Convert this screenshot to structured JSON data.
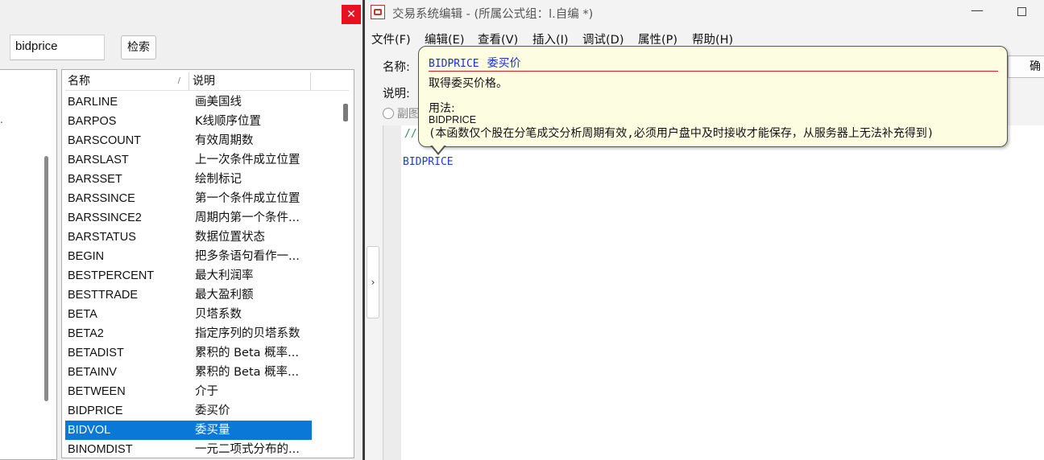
{
  "picker": {
    "search_value": "bidprice",
    "search_button": "检索",
    "columns": {
      "name": "名称",
      "desc": "说明",
      "sort_mark": "/"
    },
    "rows": [
      {
        "name": "BARLINE",
        "desc": "画美国线"
      },
      {
        "name": "BARPOS",
        "desc": "K线顺序位置"
      },
      {
        "name": "BARSCOUNT",
        "desc": "有效周期数"
      },
      {
        "name": "BARSLAST",
        "desc": "上一次条件成立位置"
      },
      {
        "name": "BARSSET",
        "desc": "绘制标记"
      },
      {
        "name": "BARSSINCE",
        "desc": "第一个条件成立位置"
      },
      {
        "name": "BARSSINCE2",
        "desc": "周期内第一个条件..."
      },
      {
        "name": "BARSTATUS",
        "desc": "数据位置状态"
      },
      {
        "name": "BEGIN",
        "desc": "把多条语句看作一..."
      },
      {
        "name": "BESTPERCENT",
        "desc": "最大利润率"
      },
      {
        "name": "BESTTRADE",
        "desc": "最大盈利额"
      },
      {
        "name": "BETA",
        "desc": "贝塔系数"
      },
      {
        "name": "BETA2",
        "desc": "指定序列的贝塔系数"
      },
      {
        "name": "BETADIST",
        "desc": "累积的 Beta 概率..."
      },
      {
        "name": "BETAINV",
        "desc": "累积的 Beta 概率..."
      },
      {
        "name": "BETWEEN",
        "desc": "介于"
      },
      {
        "name": "BIDPRICE",
        "desc": "委买价"
      },
      {
        "name": "BIDVOL",
        "desc": "委买量",
        "selected": true
      },
      {
        "name": "BINOMDIST",
        "desc": "一元二项式分布的..."
      }
    ],
    "close_glyph": "✕",
    "tree_dot": "."
  },
  "editor": {
    "title": "交易系统编辑 - (所属公式组：l.自编 *)",
    "menu": [
      "文件(F)",
      "编辑(E)",
      "查看(V)",
      "插入(I)",
      "调试(D)",
      "属性(P)",
      "帮助(H)"
    ],
    "name_label": "名称:",
    "desc_label": "说明:",
    "ok_button": "确",
    "radio_label": "副图",
    "code_fragment": "//",
    "code_line": "BIDPRICE",
    "collapse_glyph": "›",
    "minimize_glyph": "—"
  },
  "tooltip": {
    "func_name": "BIDPRICE",
    "func_cn": "委买价",
    "description": "取得委买价格。",
    "usage_label": "用法:",
    "usage": "BIDPRICE",
    "note": "(本函数仅个股在分笔成交分析周期有效,必须用户盘中及时接收才能保存，从服务器上无法补充得到)"
  }
}
